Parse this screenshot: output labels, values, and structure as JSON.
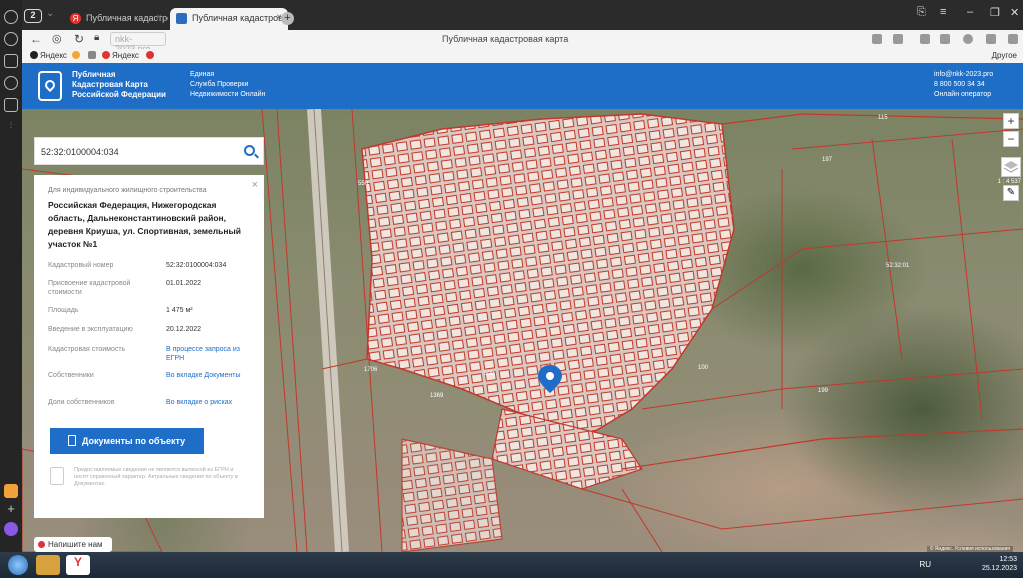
{
  "browser": {
    "tab_count": "2",
    "tabs": [
      {
        "label": "Публичная кадастровая к"
      },
      {
        "label": "Публичная кадастровая ка"
      }
    ],
    "url": "nkk-2023.pro",
    "page_title": "Публичная кадастровая карта",
    "bookmarks": [
      "Яндекс",
      "Яндекс"
    ],
    "others_label": "Другое"
  },
  "site_header": {
    "brand_lines": [
      "Публичная",
      "Кадастровая Карта",
      "Российской Федерации"
    ],
    "mid_lines": [
      "Единая",
      "Служба Проверки",
      "Недвижимости Онлайн"
    ],
    "contact_lines": [
      "info@nkk-2023.pro",
      "8 800 500 34 34",
      "Онлайн оператор"
    ]
  },
  "search": {
    "value": "52:32:0100004:034"
  },
  "card": {
    "purpose": "Для индивидуального жилищного строительства",
    "address": "Российская Федерация, Нижегородская область, Дальнеконстантиновский район, деревня Криуша, ул. Спортивная, земельный участок №1",
    "rows": [
      {
        "k": "Кадастровый номер",
        "v": "52:32:0100004:034"
      },
      {
        "k": "Присвоение кадастровой стоимости",
        "v": "01.01.2022"
      },
      {
        "k": "Площадь",
        "v": "1 475 м²"
      },
      {
        "k": "Введение в эксплуатацию",
        "v": "20.12.2022"
      },
      {
        "k": "Кадастровая стоимость",
        "v": "В процессе запроса из ЕГРН"
      },
      {
        "k": "Собственники",
        "v": "Во вкладке Документы"
      },
      {
        "k": "Доли собственников",
        "v": "Во вкладке о рисках"
      }
    ],
    "button_label": "Документы по объекту",
    "note": "Предоставляемые сведения не являются выпиской из ЕГРН и носят справочный характер. Актуальные сведения по объекту в Документах."
  },
  "map": {
    "write_us": "Напишите нам",
    "scale": "1 : 4 537",
    "attribution": "© Яндекс. Условия использования",
    "parcel_labels": [
      "115",
      "197",
      "52:32:01",
      "199",
      "100",
      "500",
      "550",
      "1706",
      "1369"
    ],
    "pin_label": "1"
  },
  "taskbar": {
    "lang": "RU",
    "time": "12:53",
    "date": "25.12.2023"
  }
}
